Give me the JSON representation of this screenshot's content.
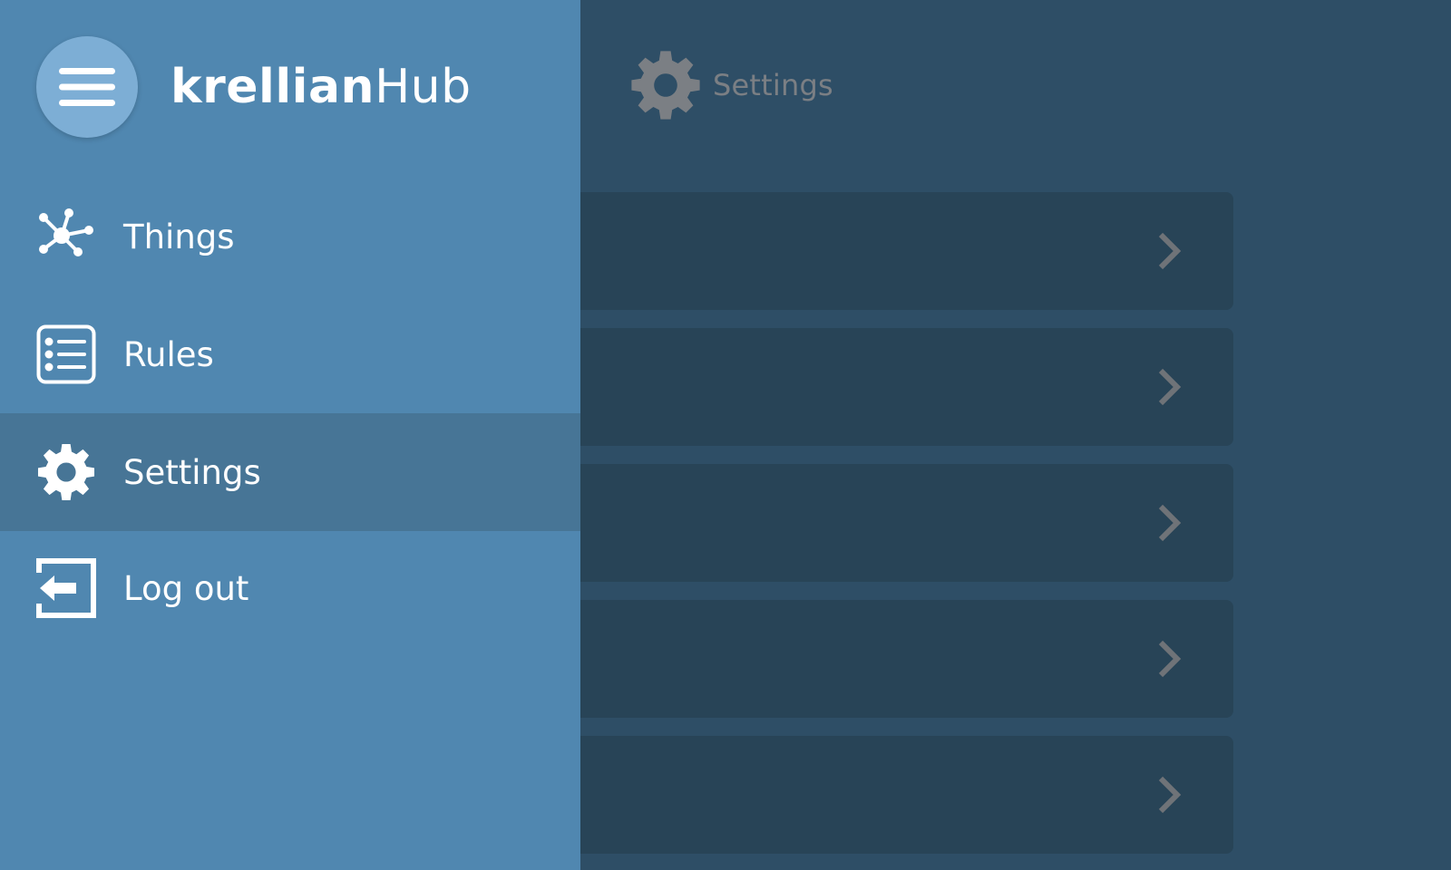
{
  "main": {
    "title": "Settings",
    "rows": [
      {
        "chevron": "chevron-right-icon"
      },
      {
        "chevron": "chevron-right-icon"
      },
      {
        "chevron": "chevron-right-icon"
      },
      {
        "chevron": "chevron-right-icon"
      },
      {
        "chevron": "chevron-right-icon"
      }
    ]
  },
  "menu": {
    "brand_bold": "krellian",
    "brand_light": "Hub",
    "items": [
      {
        "label": "Things",
        "icon": "things-network-icon"
      },
      {
        "label": "Rules",
        "icon": "rules-list-icon"
      },
      {
        "label": "Settings",
        "icon": "gear-icon",
        "selected": true
      },
      {
        "label": "Log out",
        "icon": "logout-icon"
      }
    ]
  },
  "colors": {
    "menu_bg": "#5087b0",
    "menu_selected_bg": "#477596",
    "menu_button_bg": "#7daed5",
    "page_bg": "#2e4e66",
    "row_bg": "#284457",
    "dim_text": "#7b7f84"
  }
}
